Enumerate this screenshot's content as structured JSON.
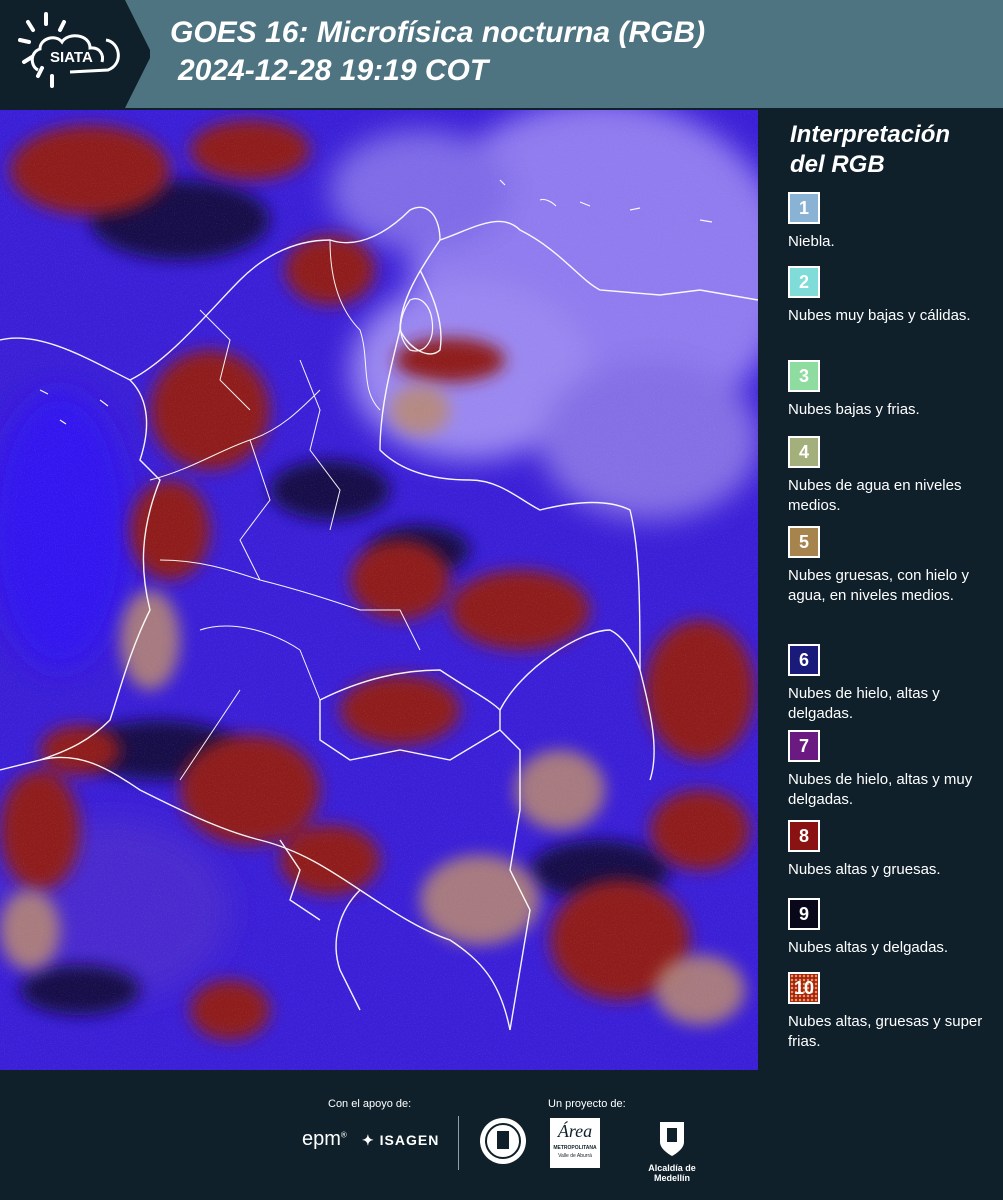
{
  "header": {
    "logo_text": "SIATA",
    "title_line1": "GOES 16: Microfísica nocturna (RGB)",
    "title_line2": "2024-12-28 19:19 COT"
  },
  "legend": {
    "title_line1": "Interpretación",
    "title_line2": "del RGB",
    "items": [
      {
        "num": "1",
        "color": "#8ab2d4",
        "desc": "Niebla."
      },
      {
        "num": "2",
        "color": "#7fdcd8",
        "desc": "Nubes muy bajas y cálidas."
      },
      {
        "num": "3",
        "color": "#8fdca0",
        "desc": "Nubes bajas y frias."
      },
      {
        "num": "4",
        "color": "#a4b07c",
        "desc": "Nubes de agua en niveles medios."
      },
      {
        "num": "5",
        "color": "#a7844e",
        "desc": "Nubes gruesas, con hielo y agua, en niveles medios."
      },
      {
        "num": "6",
        "color": "#1a1a7a",
        "desc": "Nubes de hielo, altas y delgadas."
      },
      {
        "num": "7",
        "color": "#6a1a80",
        "desc": "Nubes de hielo, altas y muy delgadas."
      },
      {
        "num": "8",
        "color": "#8a1212",
        "desc": "Nubes altas y gruesas."
      },
      {
        "num": "9",
        "color": "#08081a",
        "desc": "Nubes altas y delgadas."
      },
      {
        "num": "10",
        "color": "#a8200e",
        "desc": "Nubes altas, gruesas y super frias."
      }
    ]
  },
  "footer": {
    "support_label": "Con el apoyo de:",
    "project_label": "Un proyecto de:",
    "epm": "epm",
    "isagen": "ISAGEN",
    "area_name": "Área",
    "area_sub1": "METROPOLITANA",
    "area_sub2": "Valle de Aburrá",
    "medellin": "Alcaldía de Medellín"
  }
}
